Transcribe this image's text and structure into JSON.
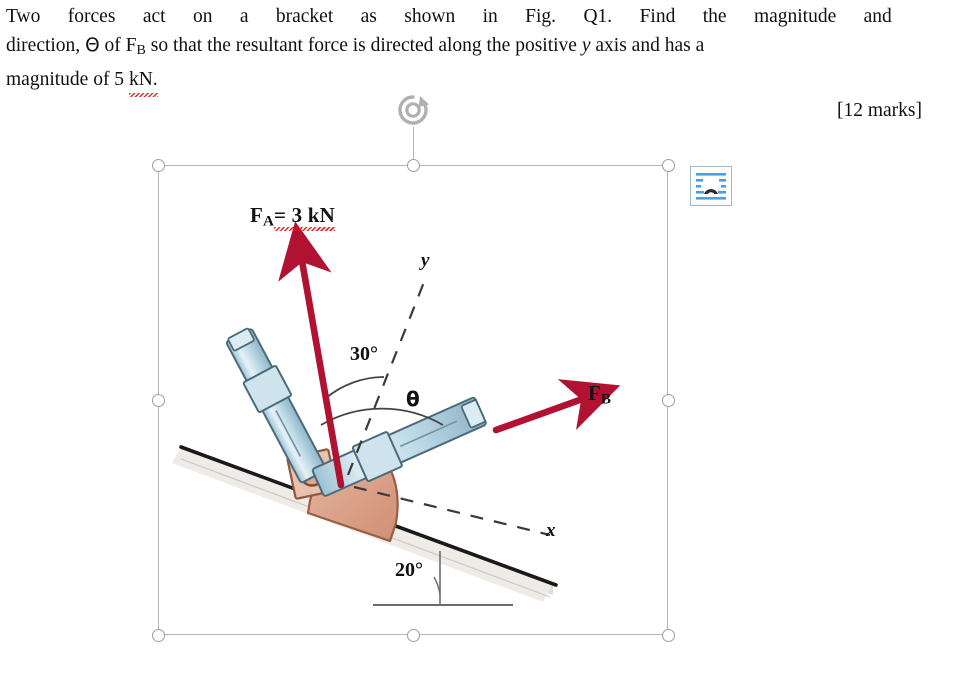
{
  "question": {
    "line1_words": [
      "Two",
      "forces",
      "act",
      "on",
      "a",
      "bracket",
      "as",
      "shown",
      "in",
      "Fig.",
      "Q1.",
      "Find",
      "the",
      "magnitude",
      "and"
    ],
    "line2_prefix": "direction,",
    "line2_theta": "Θ",
    "line2_of": "of",
    "line2_F": "F",
    "line2_F_sub": "B",
    "line2_rest_words": [
      "so",
      "that",
      "the",
      "resultant",
      "force",
      "is",
      "directed",
      "along",
      "the",
      "positive"
    ],
    "line2_y": "y",
    "line2_tail_words": [
      "axis",
      "and",
      "has",
      "a"
    ],
    "line3_prefix": "magnitude of 5",
    "line3_unit": "kN",
    "line3_period": ".",
    "marks": "[12 marks]"
  },
  "figure": {
    "labels": {
      "force_a": "F",
      "force_a_sub": "A",
      "force_a_value": "= 3 kN",
      "force_b": "F",
      "force_b_sub": "B",
      "angle_30": "30°",
      "angle_20": "20°",
      "angle_theta": "θ",
      "axis_y": "y",
      "axis_x": "x"
    },
    "colors": {
      "arrow_red": "#b21231",
      "bracket_fill": "#dca48d",
      "bracket_stroke": "#9c5c3e",
      "rod_fill": "#bcd7e4",
      "rod_stroke": "#4c6b7a",
      "incline_top": "#1a1a1a",
      "incline_face": "#eeeae6",
      "dash_gray": "#3a3a3a"
    },
    "selection": {
      "handle_count": 8,
      "rotate_handle": "rotate-handle",
      "border_color": "#b6b6b6",
      "handle_fill": "#ffffff",
      "handle_stroke": "#9e9e9e"
    }
  },
  "layout_options": {
    "name": "layout-options",
    "icon": "text-wrap-icon",
    "border_color": "#9fb8cf",
    "line_color": "#4a9fe0",
    "arch_color": "#2b2b2b"
  }
}
